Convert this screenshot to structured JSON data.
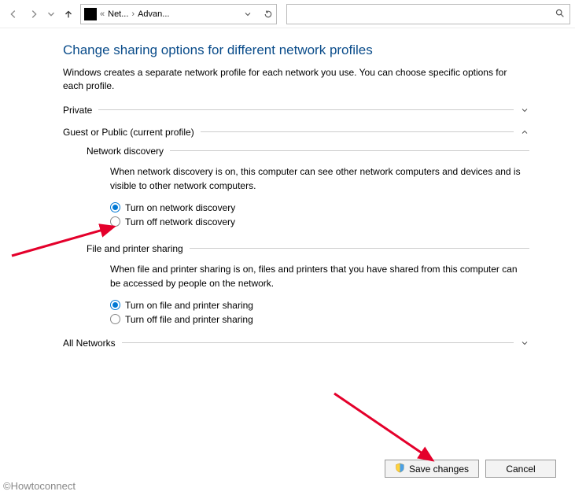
{
  "nav": {
    "breadcrumb1": "Net...",
    "breadcrumb2": "Advan..."
  },
  "search": {
    "placeholder": ""
  },
  "title": "Change sharing options for different network profiles",
  "subtitle": "Windows creates a separate network profile for each network you use. You can choose specific options for each profile.",
  "sections": {
    "private": {
      "label": "Private"
    },
    "guestpublic": {
      "label": "Guest or Public (current profile)",
      "discovery": {
        "title": "Network discovery",
        "desc": "When network discovery is on, this computer can see other network computers and devices and is visible to other network computers.",
        "on": "Turn on network discovery",
        "off": "Turn off network discovery"
      },
      "fileprint": {
        "title": "File and printer sharing",
        "desc": "When file and printer sharing is on, files and printers that you have shared from this computer can be accessed by people on the network.",
        "on": "Turn on file and printer sharing",
        "off": "Turn off file and printer sharing"
      }
    },
    "allnetworks": {
      "label": "All Networks"
    }
  },
  "buttons": {
    "save": "Save changes",
    "cancel": "Cancel"
  },
  "watermark": "©Howtoconnect"
}
